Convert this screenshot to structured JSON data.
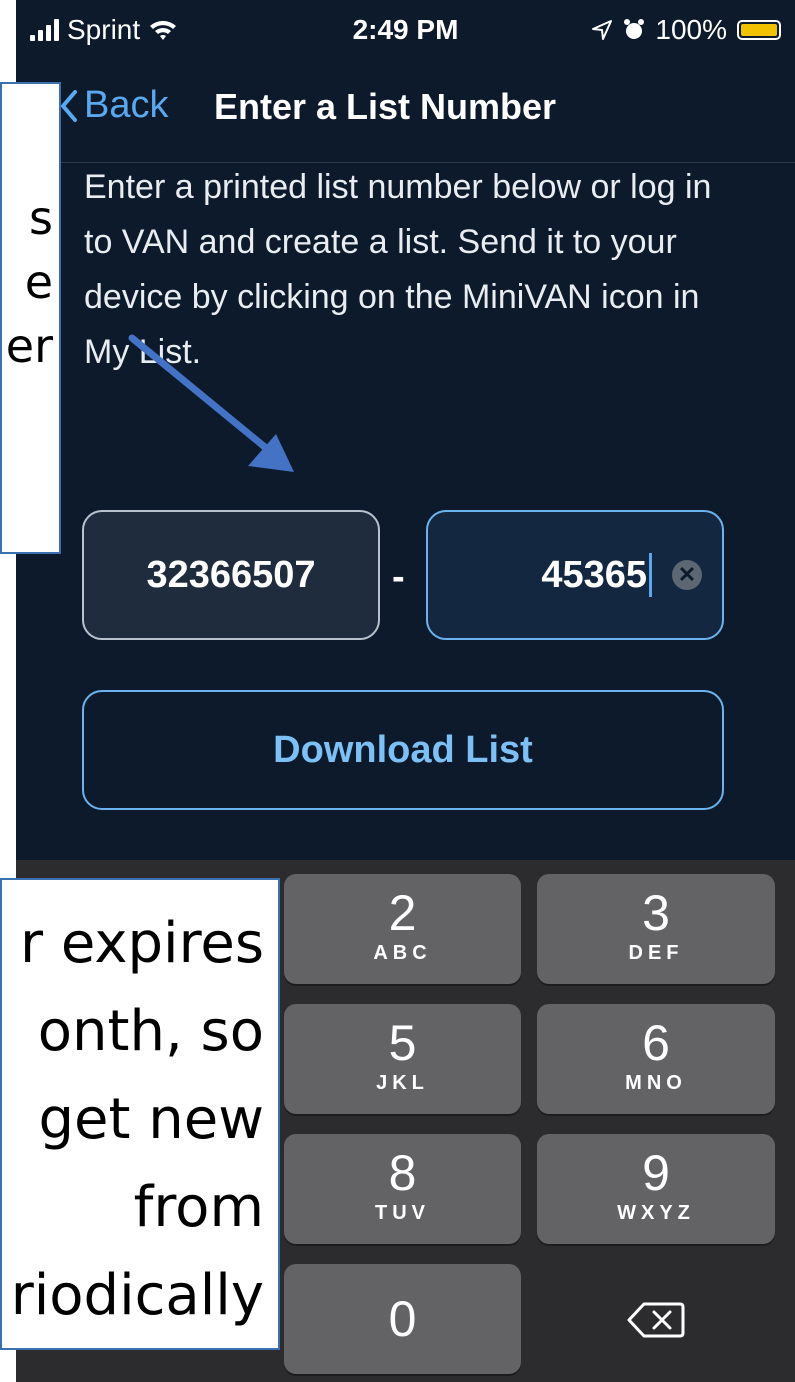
{
  "status_bar": {
    "carrier": "Sprint",
    "time": "2:49 PM",
    "battery": "100%",
    "battery_level": 1.0
  },
  "nav": {
    "back_label": "Back",
    "title": "Enter a List Number"
  },
  "instructions": "Enter a printed list number below or log in to VAN and create a list. Send it to your device by clicking on the MiniVAN icon in My List.",
  "list_number": {
    "part1": "32366507",
    "separator": "-",
    "part2": "45365"
  },
  "download_button": "Download List",
  "keypad": {
    "keys": [
      {
        "digit": "2",
        "letters": "ABC"
      },
      {
        "digit": "3",
        "letters": "DEF"
      },
      {
        "digit": "5",
        "letters": "JKL"
      },
      {
        "digit": "6",
        "letters": "MNO"
      },
      {
        "digit": "8",
        "letters": "TUV"
      },
      {
        "digit": "9",
        "letters": "WXYZ"
      },
      {
        "digit": "0",
        "letters": ""
      }
    ],
    "delete_icon": "backspace-icon"
  },
  "callouts": {
    "top_lines": [
      "s",
      "e",
      "er"
    ],
    "bottom_lines": [
      "r expires",
      "onth, so",
      "get new",
      "from",
      "riodically"
    ]
  },
  "colors": {
    "background": "#0c1a2b",
    "accent": "#5aa9f0",
    "battery": "#f2c200",
    "annotation_arrow": "#4472c4"
  }
}
